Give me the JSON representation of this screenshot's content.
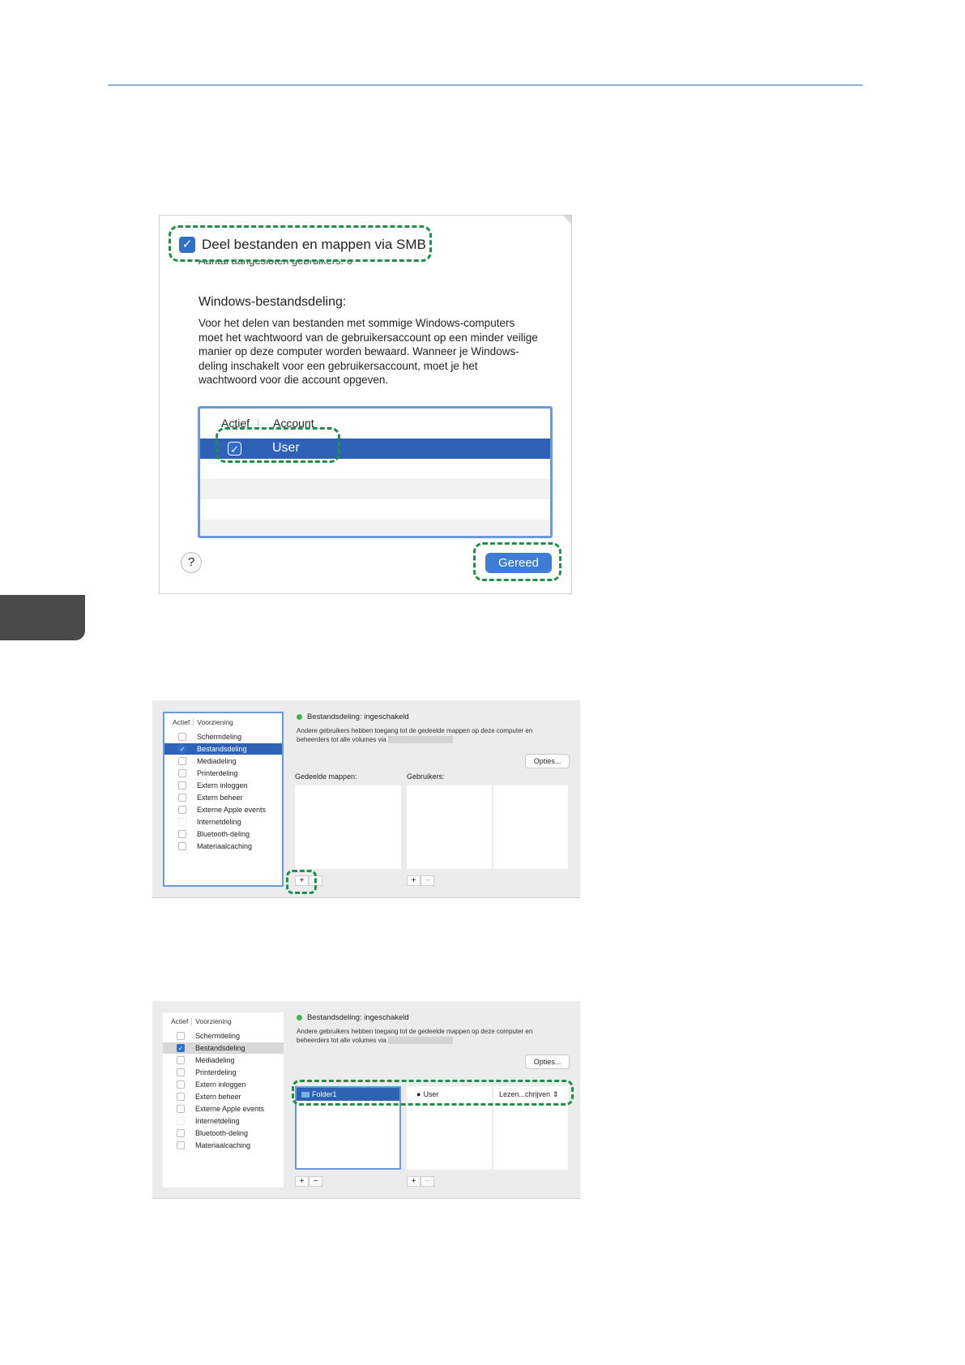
{
  "smb_dialog": {
    "smb_label": "Deel bestanden en mappen via SMB",
    "connected_users": "Aantal aangesloten gebruikers: 0",
    "windows_title": "Windows-bestandsdeling:",
    "windows_desc": "Voor het delen van bestanden met sommige Windows-computers moet het wachtwoord van de gebruikersaccount op een minder veilige manier op deze computer worden bewaard. Wanneer je Windows-deling inschakelt voor een gebruikersaccount, moet je het wachtwoord voor die account opgeven.",
    "col_active": "Actief",
    "col_account": "Account",
    "user_label": "User",
    "help_label": "?",
    "done_label": "Gereed"
  },
  "sharing_panel": {
    "col_active": "Actief",
    "col_service": "Voorziening",
    "services": [
      "Schermdeling",
      "Bestandsdeling",
      "Mediadeling",
      "Printerdeling",
      "Extern inloggen",
      "Extern beheer",
      "Externe Apple events",
      "Internetdeling",
      "Bluetooth-deling",
      "Materiaalcaching"
    ],
    "status": "Bestandsdeling: ingeschakeld",
    "status_desc": "Andere gebruikers hebben toegang tot de gedeelde mappen op deze computer en beheerders tot alle volumes via",
    "options_label": "Opties...",
    "shared_folders_label": "Gedeelde mappen:",
    "users_label": "Gebruikers:",
    "plus": "+",
    "minus": "−",
    "folder_name": "Folder1",
    "user_name": "User",
    "permission": "Lezen...chrijven"
  }
}
